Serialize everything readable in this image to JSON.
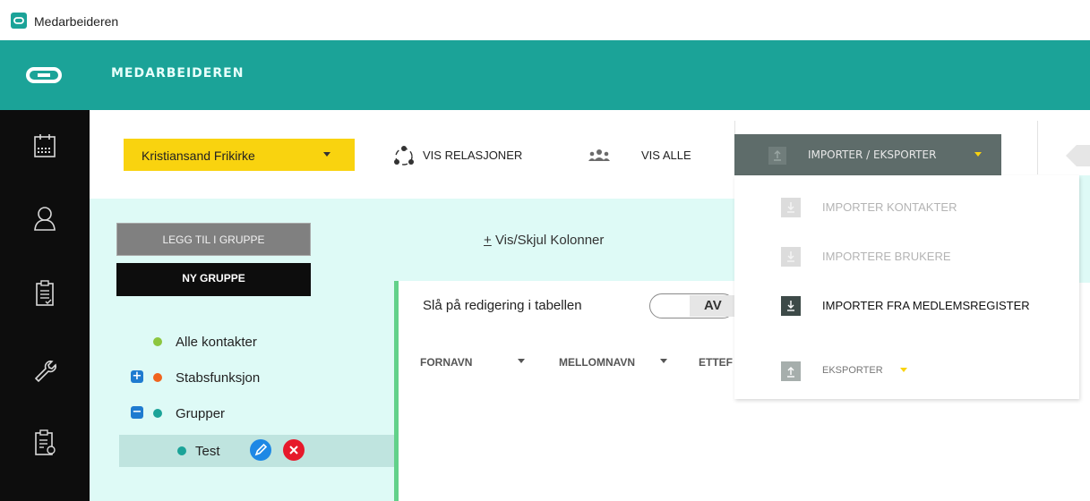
{
  "window": {
    "title": "Medarbeideren"
  },
  "header": {
    "title": "MEDARBEIDEREN"
  },
  "sidebar": {
    "items": [
      {
        "icon": "calendar-icon"
      },
      {
        "icon": "user-icon"
      },
      {
        "icon": "checklist-icon"
      },
      {
        "icon": "wrench-icon"
      },
      {
        "icon": "report-icon"
      }
    ]
  },
  "org_select": {
    "value": "Kristiansand Frikirke"
  },
  "groups": {
    "add_label": "LEGG TIL I GRUPPE",
    "new_label": "NY GRUPPE",
    "tree": [
      {
        "label": "Alle kontakter",
        "dot": "#8cc63f"
      },
      {
        "label": "Stabsfunksjon",
        "dot": "#f0641e",
        "toggle": "+"
      },
      {
        "label": "Grupper",
        "dot": "#1ba398",
        "toggle": "−"
      },
      {
        "label": "Test",
        "dot": "#1ba398"
      }
    ]
  },
  "toolbar": {
    "vis_relasjoner": "VIS RELASJONER",
    "vis_alle": "VIS ALLE",
    "import_export": "IMPORTER / EKSPORTER"
  },
  "main": {
    "toggle_columns": "Vis/Skjul Kolonner",
    "edit_label": "Slå på redigering i tabellen",
    "edit_switch": "AV",
    "columns": [
      "FORNAVN",
      "MELLOMNAVN",
      "ETTEF"
    ]
  },
  "menu": {
    "items": [
      {
        "label": "IMPORTER KONTAKTER"
      },
      {
        "label": "IMPORTERE BRUKERE"
      },
      {
        "label": "IMPORTER FRA MEDLEMSREGISTER"
      },
      {
        "label": "EKSPORTER"
      }
    ]
  },
  "colors": {
    "brand": "#1ba398",
    "accent": "#f9d30f",
    "panel": "#defaf6"
  }
}
